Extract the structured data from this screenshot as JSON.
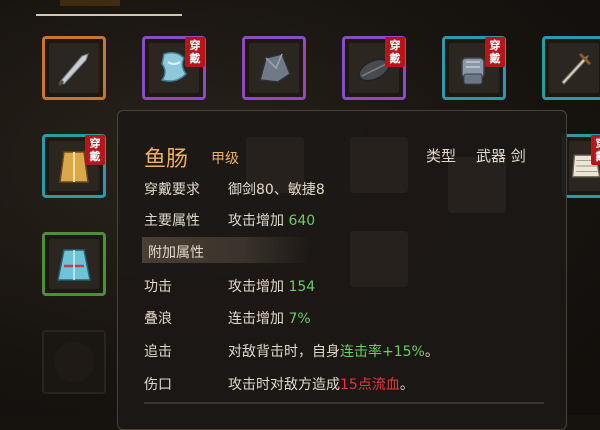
{
  "header": {},
  "badges": {
    "equipped": "穿\n戴"
  },
  "inventory": {
    "row1": [
      {
        "name": "dagger",
        "rarity": "orange",
        "equipped": false
      },
      {
        "name": "cape",
        "rarity": "purple",
        "equipped": true
      },
      {
        "name": "shoulder-armor",
        "rarity": "purple",
        "equipped": false
      },
      {
        "name": "leaf-shield",
        "rarity": "purple",
        "equipped": true
      },
      {
        "name": "gauntlet",
        "rarity": "cyan",
        "equipped": true
      },
      {
        "name": "sword",
        "rarity": "cyan",
        "equipped": false
      }
    ],
    "row2": [
      {
        "name": "gold-robe",
        "rarity": "cyan",
        "equipped": true
      },
      {
        "name": "bandage-armor",
        "rarity": "cyan",
        "equipped": true
      }
    ],
    "row3": [
      {
        "name": "blue-robe",
        "rarity": "green",
        "equipped": false
      }
    ]
  },
  "tooltip": {
    "item_name": "鱼肠",
    "grade": "甲级",
    "type_label": "类型",
    "type_value": "武器 剑",
    "requirement_label": "穿戴要求",
    "requirement_value": "御剑80、敏捷8",
    "main_attr_label": "主要属性",
    "main_attr_text": "攻击增加",
    "main_attr_value": "640",
    "extra_section_title": "附加属性",
    "affixes": [
      {
        "label": "功击",
        "text": "攻击增加",
        "value": "154"
      },
      {
        "label": "叠浪",
        "text": "连击增加",
        "value": "7%"
      }
    ],
    "effect1_label": "追击",
    "effect1_pre": "对敌背击时，自身",
    "effect1_highlight": "连击率+15%",
    "effect1_post": "。",
    "effect2_label": "伤口",
    "effect2_pre": "攻击时对敌方造成",
    "effect2_highlight": "15点流血",
    "effect2_post": "。"
  },
  "colors": {
    "orange": "#c8762a",
    "purple": "#8c4bc2",
    "cyan": "#2c9aa6",
    "green": "#4c8e3a",
    "name_gold": "#efb064",
    "stat_green": "#6acd62",
    "bleed_red": "#e03b3b"
  }
}
